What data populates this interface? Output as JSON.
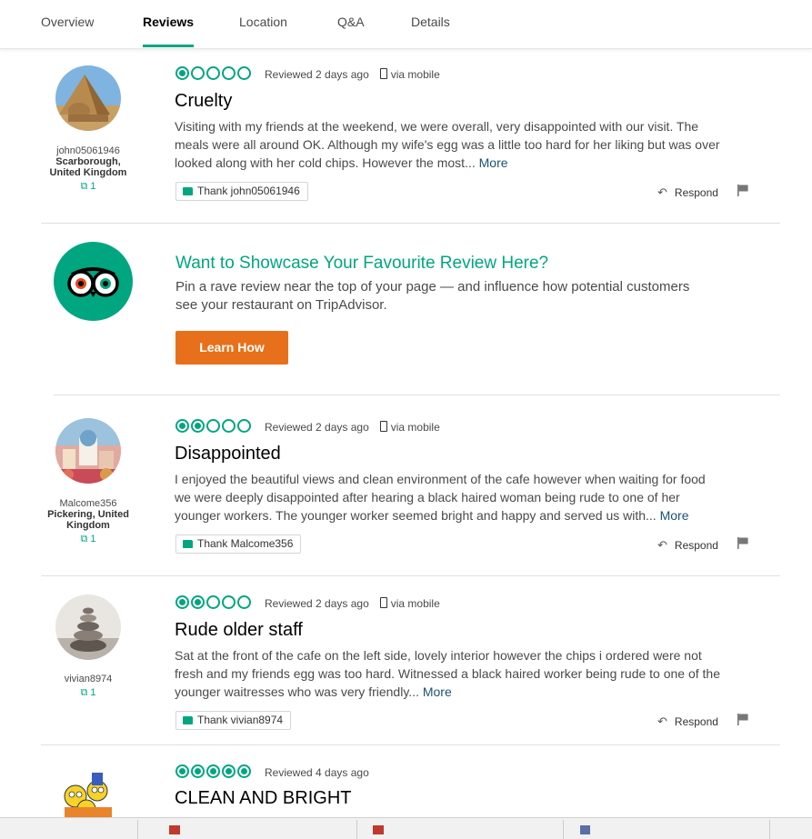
{
  "tabs": [
    {
      "label": "Overview"
    },
    {
      "label": "Reviews"
    },
    {
      "label": "Location"
    },
    {
      "label": "Q&A"
    },
    {
      "label": "Details"
    }
  ],
  "accent_color": "#00a680",
  "button_color": "#e8701a",
  "reviews": [
    {
      "username": "john05061946",
      "location": "Scarborough, United Kingdom",
      "contributions": "1",
      "rating": 1,
      "reviewed": "Reviewed 2 days ago",
      "via": "via mobile",
      "title": "Cruelty",
      "body": "Visiting with my friends at the weekend, we were overall, very disappointed with our visit. The meals were all around OK. Although my wife's egg was a little too hard for her liking but was over looked along with her cold chips. However the most...",
      "more": "More",
      "thank": "Thank john05061946",
      "respond": "Respond"
    },
    {
      "username": "Malcome356",
      "location": "Pickering, United Kingdom",
      "contributions": "1",
      "rating": 2,
      "reviewed": "Reviewed 2 days ago",
      "via": "via mobile",
      "title": "Disappointed",
      "body": "I enjoyed the beautiful views and clean environment of the cafe however when waiting for food we were deeply disappointed after hearing a black haired woman being rude to one of her younger workers. The younger worker seemed bright and happy and served us with...",
      "more": "More",
      "thank": "Thank Malcome356",
      "respond": "Respond"
    },
    {
      "username": "vivian8974",
      "location": "",
      "contributions": "1",
      "rating": 2,
      "reviewed": "Reviewed 2 days ago",
      "via": "via mobile",
      "title": "Rude older staff",
      "body": "Sat at the front of the cafe on the left side, lovely interior however the chips i ordered were not fresh and my friends egg was too hard. Witnessed a black haired worker being rude to one of the younger waitresses who was very friendly...",
      "more": "More",
      "thank": "Thank vivian8974",
      "respond": "Respond"
    },
    {
      "rating": 5,
      "reviewed": "Reviewed 4 days ago",
      "title": "CLEAN AND BRIGHT"
    }
  ],
  "promo": {
    "title": "Want to Showcase Your Favourite Review Here?",
    "text": "Pin a rave review near the top of your page — and influence how potential customers see your restaurant on TripAdvisor.",
    "button": "Learn How"
  }
}
